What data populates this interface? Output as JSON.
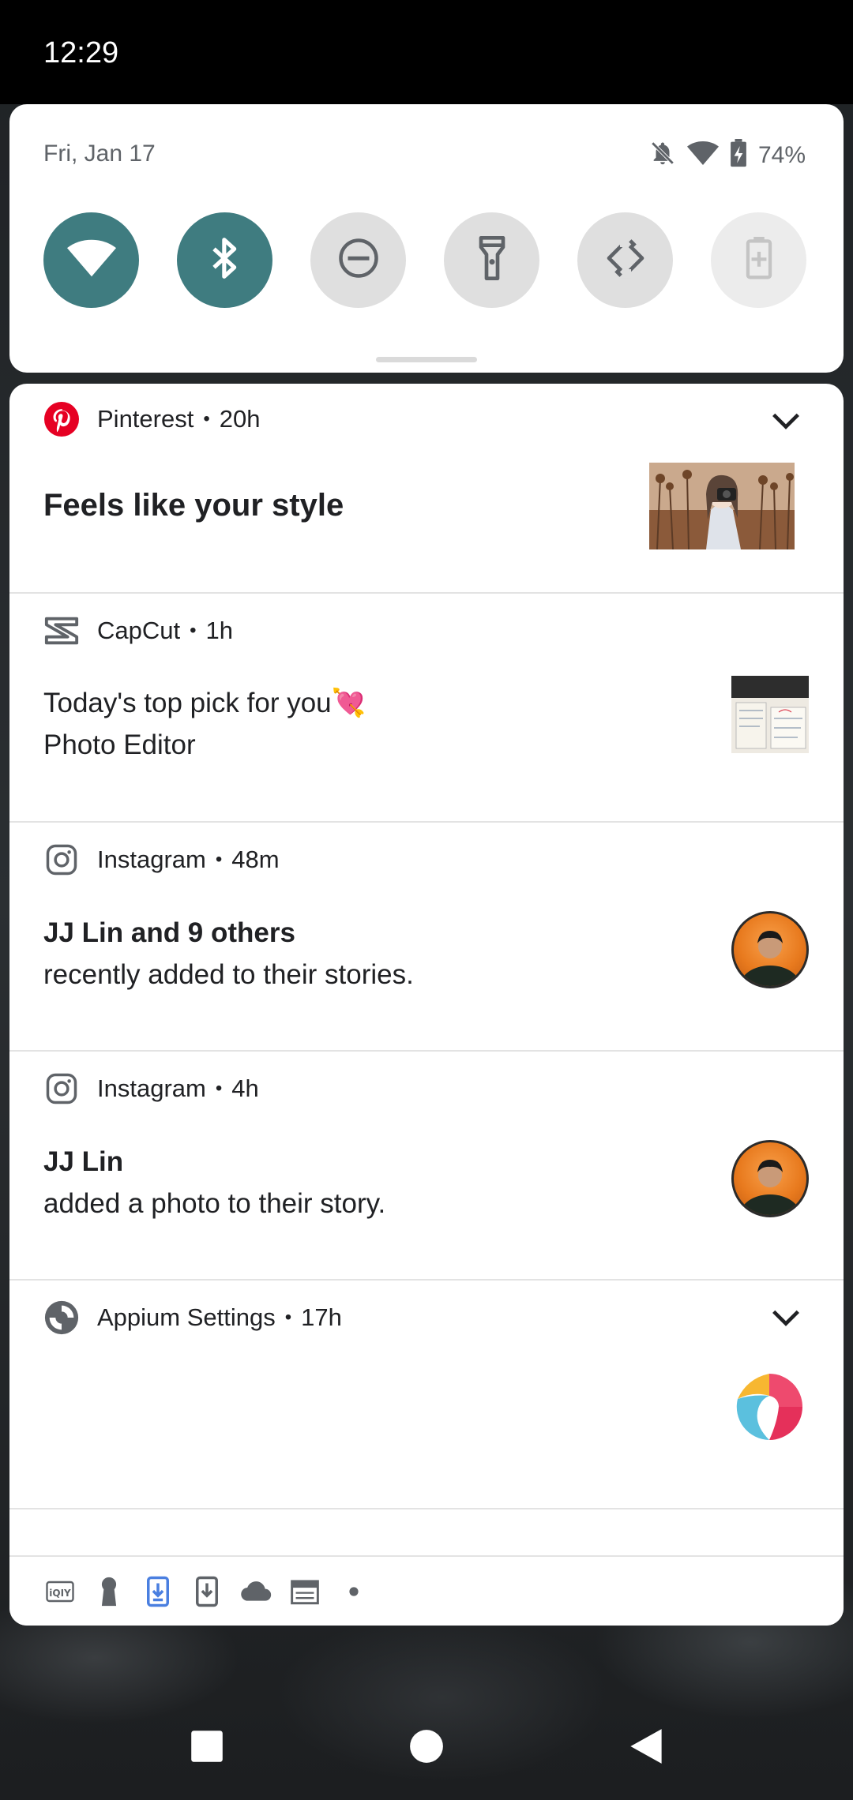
{
  "status_bar": {
    "time": "12:29"
  },
  "quick_settings": {
    "date": "Fri, Jan 17",
    "battery_percent": "74%",
    "tiles": [
      {
        "id": "wifi",
        "icon": "wifi-icon",
        "state": "on"
      },
      {
        "id": "bluetooth",
        "icon": "bluetooth-icon",
        "state": "on"
      },
      {
        "id": "dnd",
        "icon": "do-not-disturb-icon",
        "state": "off"
      },
      {
        "id": "flashlight",
        "icon": "flashlight-icon",
        "state": "off"
      },
      {
        "id": "autorotate",
        "icon": "autorotate-icon",
        "state": "off"
      },
      {
        "id": "battery-saver",
        "icon": "battery-saver-icon",
        "state": "disabled"
      }
    ],
    "accent_color": "#3f7c80"
  },
  "notifications": [
    {
      "app": "Pinterest",
      "time": "20h",
      "title": "Feels like your style",
      "body": "",
      "icon": "pinterest-icon",
      "expandable": true
    },
    {
      "app": "CapCut",
      "time": "1h",
      "title": "Today's top pick for you💘",
      "body": "Photo Editor",
      "icon": "capcut-icon",
      "expandable": false
    },
    {
      "app": "Instagram",
      "time": "48m",
      "title": "JJ Lin and 9 others",
      "body": "recently added to their stories.",
      "icon": "instagram-icon",
      "expandable": false
    },
    {
      "app": "Instagram",
      "time": "4h",
      "title": "JJ Lin",
      "body": "added a photo to their story.",
      "icon": "instagram-icon",
      "expandable": false
    },
    {
      "app": "Appium Settings",
      "time": "17h",
      "title": "",
      "body": "",
      "icon": "appium-icon",
      "expandable": true
    }
  ],
  "separator": "•",
  "tray_icons": [
    "iqiyi-icon",
    "keyhole-icon",
    "download-icon",
    "download-phone-icon",
    "cloud-icon",
    "calendar-icon",
    "more-dot-icon"
  ],
  "nav": [
    "recents-button",
    "home-button",
    "back-button"
  ]
}
